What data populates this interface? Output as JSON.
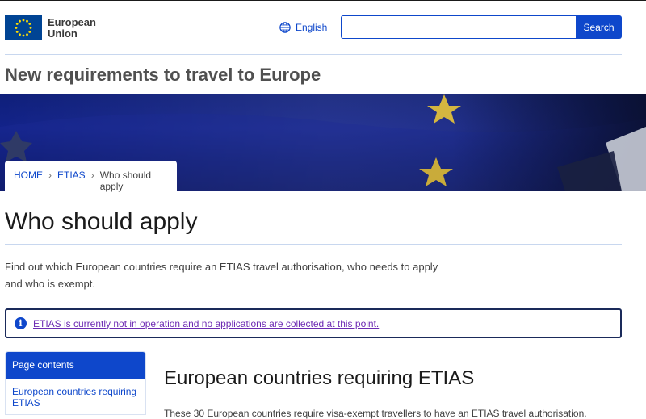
{
  "header": {
    "logo_line1": "European",
    "logo_line2": "Union",
    "language_label": "English",
    "search_placeholder": "",
    "search_button": "Search"
  },
  "site_title": "New requirements to travel to Europe",
  "breadcrumb": [
    "HOME",
    "ETIAS",
    "Who should apply"
  ],
  "page_title": "Who should apply",
  "intro": "Find out which European countries require an ETIAS travel authorisation, who needs to apply and who is exempt.",
  "notice": {
    "text": "ETIAS is currently not in operation and no applications are collected at this point."
  },
  "toc": {
    "heading": "Page contents",
    "items": [
      "European countries requiring ETIAS"
    ]
  },
  "section": {
    "title": "European countries requiring ETIAS",
    "text": "These 30 European countries require visa-exempt travellers to have an ETIAS travel authorisation."
  },
  "colors": {
    "accent": "#0e47cb",
    "eu_blue": "#004494",
    "eu_gold": "#ffdd00",
    "visited_link": "#6d2bb3"
  }
}
